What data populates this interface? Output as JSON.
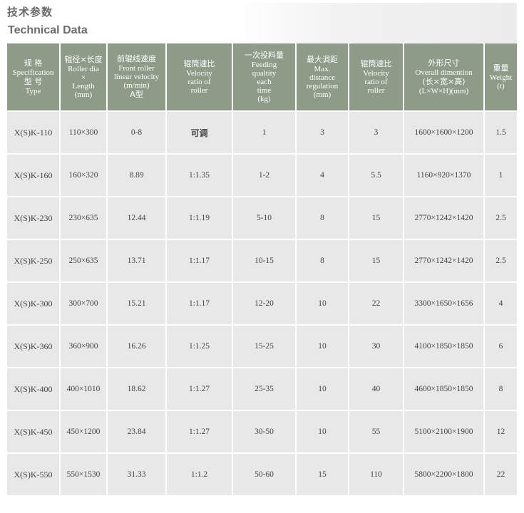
{
  "header": {
    "title_cn": "技术参数",
    "title_en": "Technical Data"
  },
  "table": {
    "columns": [
      {
        "cn": "规 格",
        "en1": "Specification",
        "cn2": "型 号",
        "en2": "Type"
      },
      {
        "cn": "辊径×长度",
        "en1": "Roller dia",
        "cn2": "×",
        "en2": "Length",
        "en3": "(mm)"
      },
      {
        "cn": "前辊线速度",
        "en1": "Front roller",
        "en2": "linear velocity",
        "en3": "(m/min)",
        "cn2": "A型"
      },
      {
        "cn": "辊筒速比",
        "en1": "Velocity",
        "en2": "ratio of",
        "en3": "roller"
      },
      {
        "cn": "一次投料量",
        "en1": "Feeding",
        "en2": "qualtity",
        "en3": "each",
        "en4": "time",
        "en5": "(kg)"
      },
      {
        "cn": "最大调距",
        "en1": "Max.",
        "en2": "distance",
        "en3": "regulation",
        "en4": "(mm)"
      },
      {
        "cn": "辊筒速比",
        "en1": "Velocity",
        "en2": "ratio of",
        "en3": "roller"
      },
      {
        "cn": "外形尺寸",
        "en1": "Overall dimention",
        "cn2": "(长×宽×高)",
        "en2": "(L×W×H)(mm)"
      },
      {
        "cn": "重量",
        "en1": "Weight",
        "en2": "(t)"
      }
    ],
    "rows": [
      [
        "X(S)K-110",
        "110×300",
        "0-8",
        "可调",
        "1",
        "3",
        "3",
        "1600×1600×1200",
        "1.5"
      ],
      [
        "X(S)K-160",
        "160×320",
        "8.89",
        "1:1.35",
        "1-2",
        "4",
        "5.5",
        "1160×920×1370",
        "1"
      ],
      [
        "X(S)K-230",
        "230×635",
        "12.44",
        "1:1.19",
        "5-10",
        "8",
        "15",
        "2770×1242×1420",
        "2.5"
      ],
      [
        "X(S)K-250",
        "250×635",
        "13.71",
        "1:1.17",
        "10-15",
        "8",
        "15",
        "2770×1242×1420",
        "2.5"
      ],
      [
        "X(S)K-300",
        "300×700",
        "15.21",
        "1:1.17",
        "12-20",
        "10",
        "22",
        "3300×1650×1656",
        "4"
      ],
      [
        "X(S)K-360",
        "360×900",
        "16.26",
        "1:1.25",
        "15-25",
        "10",
        "30",
        "4100×1850×1850",
        "6"
      ],
      [
        "X(S)K-400",
        "400×1010",
        "18.62",
        "1:1.27",
        "25-35",
        "10",
        "40",
        "4600×1850×1850",
        "8"
      ],
      [
        "X(S)K-450",
        "450×1200",
        "23.84",
        "1:1.27",
        "30-50",
        "10",
        "55",
        "5100×2100×1900",
        "12"
      ],
      [
        "X(S)K-550",
        "550×1530",
        "31.33",
        "1:1.2",
        "50-60",
        "15",
        "110",
        "5800×2200×1800",
        "22"
      ]
    ]
  }
}
